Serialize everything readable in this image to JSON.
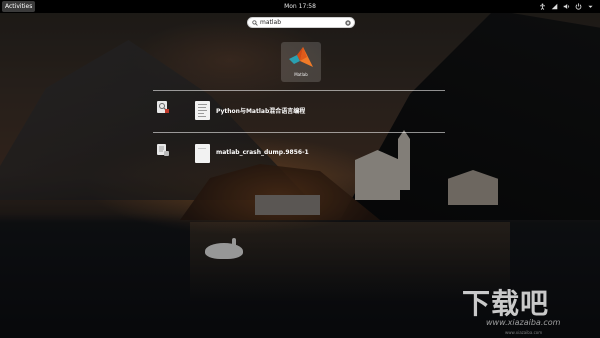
{
  "top_bar": {
    "activities_label": "Activities",
    "clock": "Mon 17:58"
  },
  "search": {
    "query": "matlab"
  },
  "app_results": [
    {
      "label": "Matlab",
      "icon": "matlab-icon"
    }
  ],
  "file_results": [
    {
      "name": "Python与Matlab混合语言编程",
      "provider_icon": "document-viewer-icon"
    },
    {
      "name": "matlab_crash_dump.9856-1",
      "provider_icon": "files-icon"
    }
  ],
  "watermark": {
    "logo_text": "下载吧",
    "url": "www.xiazaiba.com",
    "small_text": "www.xiazaiba.com"
  },
  "colors": {
    "top_bar": "#000000",
    "matlab_orange": "#e05a1a",
    "matlab_teal": "#2a9fb0"
  }
}
